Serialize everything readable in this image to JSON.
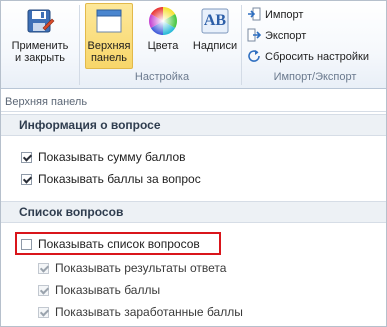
{
  "ribbon": {
    "apply_close": {
      "line1": "Применить",
      "line2": "и закрыть"
    },
    "top_panel": {
      "line1": "Верхняя",
      "line2": "панель"
    },
    "colors": "Цвета",
    "captions": "Надписи",
    "captions_icon_letters": "AB",
    "group_settings": "Настройка",
    "import": "Импорт",
    "export": "Экспорт",
    "reset": "Сбросить настройки",
    "group_import_export": "Импорт/Экспорт"
  },
  "panel": {
    "title": "Верхняя панель",
    "section_info": "Информация о вопросе",
    "show_total_score": "Показывать сумму баллов",
    "show_question_score": "Показывать баллы за вопрос",
    "section_list": "Список вопросов",
    "show_question_list": "Показывать список вопросов",
    "show_answer_results": "Показывать результаты ответа",
    "show_scores": "Показывать баллы",
    "show_earned_scores": "Показывать заработанные баллы"
  },
  "state": {
    "show_total_score": true,
    "show_question_score": true,
    "show_question_list": false,
    "show_answer_results": true,
    "show_scores": true,
    "show_earned_scores": true
  },
  "colors": {
    "highlight_border": "#d9151b",
    "active_button": "#fde89a",
    "ribbon_label": "#6b7a8e"
  }
}
